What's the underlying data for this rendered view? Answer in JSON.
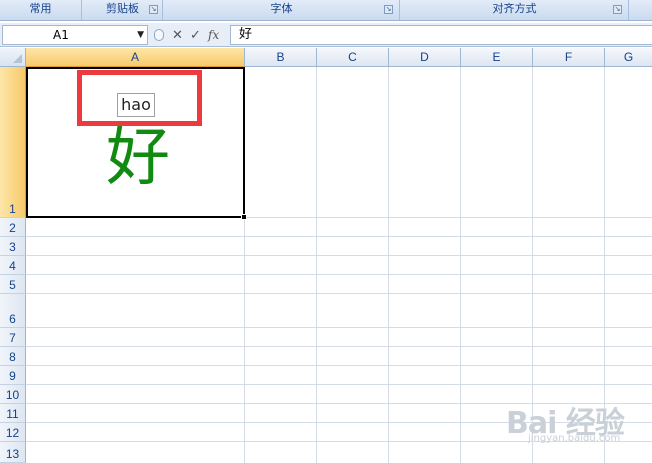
{
  "ribbon": {
    "groups": [
      {
        "label": "常用"
      },
      {
        "label": "剪贴板"
      },
      {
        "label": "字体"
      },
      {
        "label": "对齐方式"
      }
    ]
  },
  "formula_bar": {
    "name_box": "A1",
    "cancel_glyph": "✕",
    "enter_glyph": "✓",
    "fx_label": "fx",
    "value": "好"
  },
  "columns": [
    "A",
    "B",
    "C",
    "D",
    "E",
    "F",
    "G"
  ],
  "rows": [
    "1",
    "2",
    "3",
    "4",
    "5",
    "6",
    "7",
    "8",
    "9",
    "10",
    "11",
    "12",
    "13"
  ],
  "selected_cell": "A1",
  "cell_a1": {
    "pinyin": "hao",
    "text": "好",
    "text_color": "#118a11"
  },
  "highlight": {
    "color": "#ed3a3f"
  },
  "watermark": {
    "brand": "Bai 经验",
    "url": "jingyan.baidu.com"
  }
}
